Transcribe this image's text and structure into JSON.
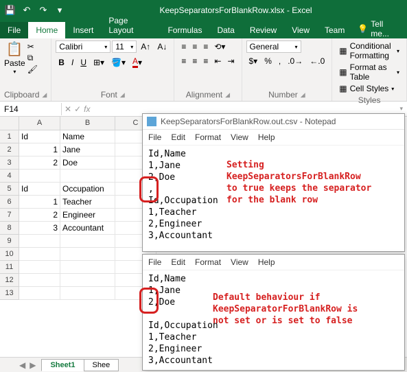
{
  "title": "KeepSeparatorsForBlankRow.xlsx - Excel",
  "qat": {
    "save": "💾",
    "undo": "↶",
    "redo": "↷",
    "more": "▾"
  },
  "tabs": {
    "file": "File",
    "home": "Home",
    "insert": "Insert",
    "page_layout": "Page Layout",
    "formulas": "Formulas",
    "data": "Data",
    "review": "Review",
    "view": "View",
    "team": "Team"
  },
  "tell_me": "Tell me...",
  "ribbon": {
    "clipboard": {
      "title": "Clipboard",
      "paste": "Paste"
    },
    "font": {
      "title": "Font",
      "name": "Calibri",
      "size": "11"
    },
    "alignment": {
      "title": "Alignment"
    },
    "number": {
      "title": "Number",
      "format": "General"
    },
    "styles": {
      "title": "Styles",
      "cond": "Conditional Formatting",
      "table": "Format as Table",
      "cell": "Cell Styles"
    }
  },
  "name_box": "F14",
  "columns": [
    "A",
    "B",
    "C"
  ],
  "rows": [
    "1",
    "2",
    "3",
    "4",
    "5",
    "6",
    "7",
    "8",
    "9",
    "10",
    "11",
    "12",
    "13"
  ],
  "cells": {
    "r1": {
      "a": "Id",
      "b": "Name"
    },
    "r2": {
      "a": "1",
      "b": "Jane"
    },
    "r3": {
      "a": "2",
      "b": "Doe"
    },
    "r5": {
      "a": "Id",
      "b": "Occupation"
    },
    "r6": {
      "a": "1",
      "b": "Teacher"
    },
    "r7": {
      "a": "2",
      "b": "Engineer"
    },
    "r8": {
      "a": "3",
      "b": "Accountant"
    }
  },
  "sheet_tabs": {
    "sheet1": "Sheet1",
    "sheet2": "Shee"
  },
  "notepad": {
    "title": "KeepSeparatorsForBlankRow.out.csv - Notepad",
    "menu": {
      "file": "File",
      "edit": "Edit",
      "format": "Format",
      "view": "View",
      "help": "Help"
    },
    "body1": "Id,Name\n1,Jane\n2,Doe\n,\nId,Occupation\n1,Teacher\n2,Engineer\n3,Accountant",
    "body2": "Id,Name\n1,Jane\n2,Doe\n\nId,Occupation\n1,Teacher\n2,Engineer\n3,Accountant"
  },
  "anno1": "Setting\nKeepSeparatorsForBlankRow\nto true keeps the separator\nfor the blank row",
  "anno2": "Default behaviour if\nKeepSeparatorForBlankRow is\nnot set or is set to false"
}
